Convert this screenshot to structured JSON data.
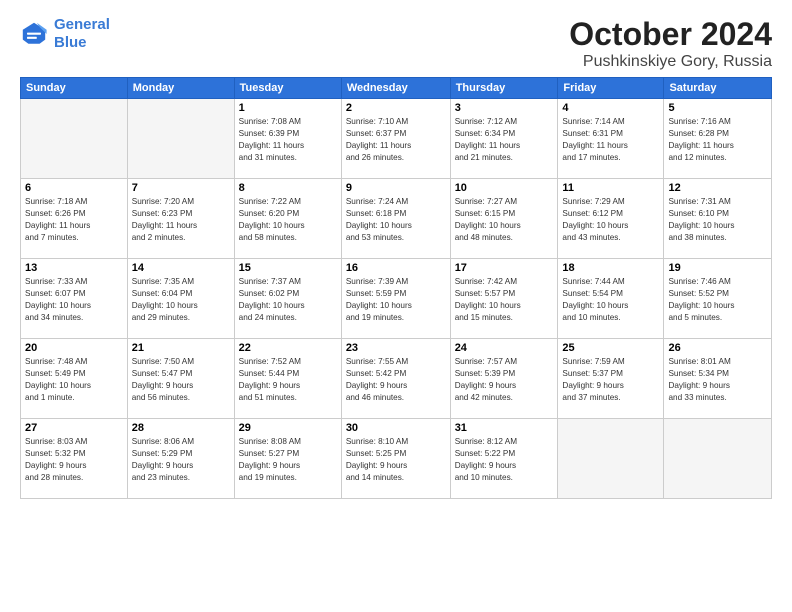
{
  "logo": {
    "line1": "General",
    "line2": "Blue"
  },
  "title": "October 2024",
  "subtitle": "Pushkinskiye Gory, Russia",
  "weekdays": [
    "Sunday",
    "Monday",
    "Tuesday",
    "Wednesday",
    "Thursday",
    "Friday",
    "Saturday"
  ],
  "weeks": [
    [
      {
        "day": "",
        "info": ""
      },
      {
        "day": "",
        "info": ""
      },
      {
        "day": "1",
        "info": "Sunrise: 7:08 AM\nSunset: 6:39 PM\nDaylight: 11 hours\nand 31 minutes."
      },
      {
        "day": "2",
        "info": "Sunrise: 7:10 AM\nSunset: 6:37 PM\nDaylight: 11 hours\nand 26 minutes."
      },
      {
        "day": "3",
        "info": "Sunrise: 7:12 AM\nSunset: 6:34 PM\nDaylight: 11 hours\nand 21 minutes."
      },
      {
        "day": "4",
        "info": "Sunrise: 7:14 AM\nSunset: 6:31 PM\nDaylight: 11 hours\nand 17 minutes."
      },
      {
        "day": "5",
        "info": "Sunrise: 7:16 AM\nSunset: 6:28 PM\nDaylight: 11 hours\nand 12 minutes."
      }
    ],
    [
      {
        "day": "6",
        "info": "Sunrise: 7:18 AM\nSunset: 6:26 PM\nDaylight: 11 hours\nand 7 minutes."
      },
      {
        "day": "7",
        "info": "Sunrise: 7:20 AM\nSunset: 6:23 PM\nDaylight: 11 hours\nand 2 minutes."
      },
      {
        "day": "8",
        "info": "Sunrise: 7:22 AM\nSunset: 6:20 PM\nDaylight: 10 hours\nand 58 minutes."
      },
      {
        "day": "9",
        "info": "Sunrise: 7:24 AM\nSunset: 6:18 PM\nDaylight: 10 hours\nand 53 minutes."
      },
      {
        "day": "10",
        "info": "Sunrise: 7:27 AM\nSunset: 6:15 PM\nDaylight: 10 hours\nand 48 minutes."
      },
      {
        "day": "11",
        "info": "Sunrise: 7:29 AM\nSunset: 6:12 PM\nDaylight: 10 hours\nand 43 minutes."
      },
      {
        "day": "12",
        "info": "Sunrise: 7:31 AM\nSunset: 6:10 PM\nDaylight: 10 hours\nand 38 minutes."
      }
    ],
    [
      {
        "day": "13",
        "info": "Sunrise: 7:33 AM\nSunset: 6:07 PM\nDaylight: 10 hours\nand 34 minutes."
      },
      {
        "day": "14",
        "info": "Sunrise: 7:35 AM\nSunset: 6:04 PM\nDaylight: 10 hours\nand 29 minutes."
      },
      {
        "day": "15",
        "info": "Sunrise: 7:37 AM\nSunset: 6:02 PM\nDaylight: 10 hours\nand 24 minutes."
      },
      {
        "day": "16",
        "info": "Sunrise: 7:39 AM\nSunset: 5:59 PM\nDaylight: 10 hours\nand 19 minutes."
      },
      {
        "day": "17",
        "info": "Sunrise: 7:42 AM\nSunset: 5:57 PM\nDaylight: 10 hours\nand 15 minutes."
      },
      {
        "day": "18",
        "info": "Sunrise: 7:44 AM\nSunset: 5:54 PM\nDaylight: 10 hours\nand 10 minutes."
      },
      {
        "day": "19",
        "info": "Sunrise: 7:46 AM\nSunset: 5:52 PM\nDaylight: 10 hours\nand 5 minutes."
      }
    ],
    [
      {
        "day": "20",
        "info": "Sunrise: 7:48 AM\nSunset: 5:49 PM\nDaylight: 10 hours\nand 1 minute."
      },
      {
        "day": "21",
        "info": "Sunrise: 7:50 AM\nSunset: 5:47 PM\nDaylight: 9 hours\nand 56 minutes."
      },
      {
        "day": "22",
        "info": "Sunrise: 7:52 AM\nSunset: 5:44 PM\nDaylight: 9 hours\nand 51 minutes."
      },
      {
        "day": "23",
        "info": "Sunrise: 7:55 AM\nSunset: 5:42 PM\nDaylight: 9 hours\nand 46 minutes."
      },
      {
        "day": "24",
        "info": "Sunrise: 7:57 AM\nSunset: 5:39 PM\nDaylight: 9 hours\nand 42 minutes."
      },
      {
        "day": "25",
        "info": "Sunrise: 7:59 AM\nSunset: 5:37 PM\nDaylight: 9 hours\nand 37 minutes."
      },
      {
        "day": "26",
        "info": "Sunrise: 8:01 AM\nSunset: 5:34 PM\nDaylight: 9 hours\nand 33 minutes."
      }
    ],
    [
      {
        "day": "27",
        "info": "Sunrise: 8:03 AM\nSunset: 5:32 PM\nDaylight: 9 hours\nand 28 minutes."
      },
      {
        "day": "28",
        "info": "Sunrise: 8:06 AM\nSunset: 5:29 PM\nDaylight: 9 hours\nand 23 minutes."
      },
      {
        "day": "29",
        "info": "Sunrise: 8:08 AM\nSunset: 5:27 PM\nDaylight: 9 hours\nand 19 minutes."
      },
      {
        "day": "30",
        "info": "Sunrise: 8:10 AM\nSunset: 5:25 PM\nDaylight: 9 hours\nand 14 minutes."
      },
      {
        "day": "31",
        "info": "Sunrise: 8:12 AM\nSunset: 5:22 PM\nDaylight: 9 hours\nand 10 minutes."
      },
      {
        "day": "",
        "info": ""
      },
      {
        "day": "",
        "info": ""
      }
    ]
  ]
}
